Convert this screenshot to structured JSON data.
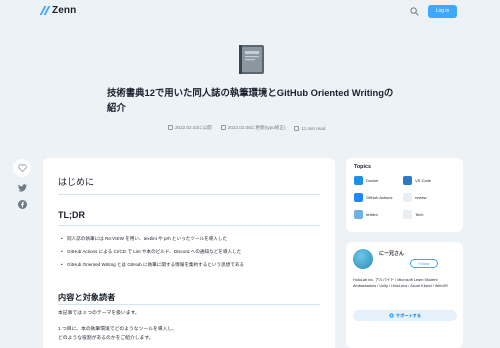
{
  "header": {
    "logo_text": "Zenn",
    "login_label": "Log in"
  },
  "article": {
    "title": "技術書典12で用いた同人誌の執筆環境とGitHub Oriented Writingの紹介",
    "published": "2022.02.03に公開",
    "updated": "2022.02.05に更新(typo修正)",
    "read_time": "11 min read",
    "toc_heading": "はじめに",
    "h_tldr": "TL;DR",
    "bullets": [
      "同人誌の執筆には Re:VIEW を用い、textlint や prh といったツールを導入した",
      "GitHub Actions による CI/CD で Lint や本のビルド、Discord への通知などを導入した",
      "GitHub Oriented Writing とは GitHub に執筆に関する情報を集約するという思想である"
    ],
    "h_scope": "内容と対象読者",
    "para1": "本記事では 2 つのテーマを扱います。",
    "para2": "1 つ目に、本の執筆環境でどのようなツールを導入し、",
    "para3": "どのような役割があるのかをご紹介します。"
  },
  "topics": {
    "title": "Topics",
    "items": [
      {
        "label": "Docker",
        "color": "#1d91e6",
        "icon": "docker-icon"
      },
      {
        "label": "VS Code",
        "color": "#2a7ac6",
        "icon": "vscode-icon"
      },
      {
        "label": "GitHub Actions",
        "color": "#2088ff",
        "icon": "github-actions-icon"
      },
      {
        "label": "review",
        "color": "#e9eef3",
        "icon": "review-icon"
      },
      {
        "label": "textlint",
        "color": "#6fb1e0",
        "icon": "textlint-icon"
      },
      {
        "label": "Tech",
        "color": "#e9eef3",
        "icon": "tech-icon"
      }
    ]
  },
  "author": {
    "name": "にー兄さん",
    "follow_label": "Follow",
    "bio": "HoloLab inc. アルバイト / Microsoft Learn Student Ambassadors / Unity / HoloLens / Azure Kinect / WebXR",
    "support_label": "サポートする"
  },
  "colors": {
    "accent": "#3ea8ff",
    "background": "#edf2f7"
  }
}
